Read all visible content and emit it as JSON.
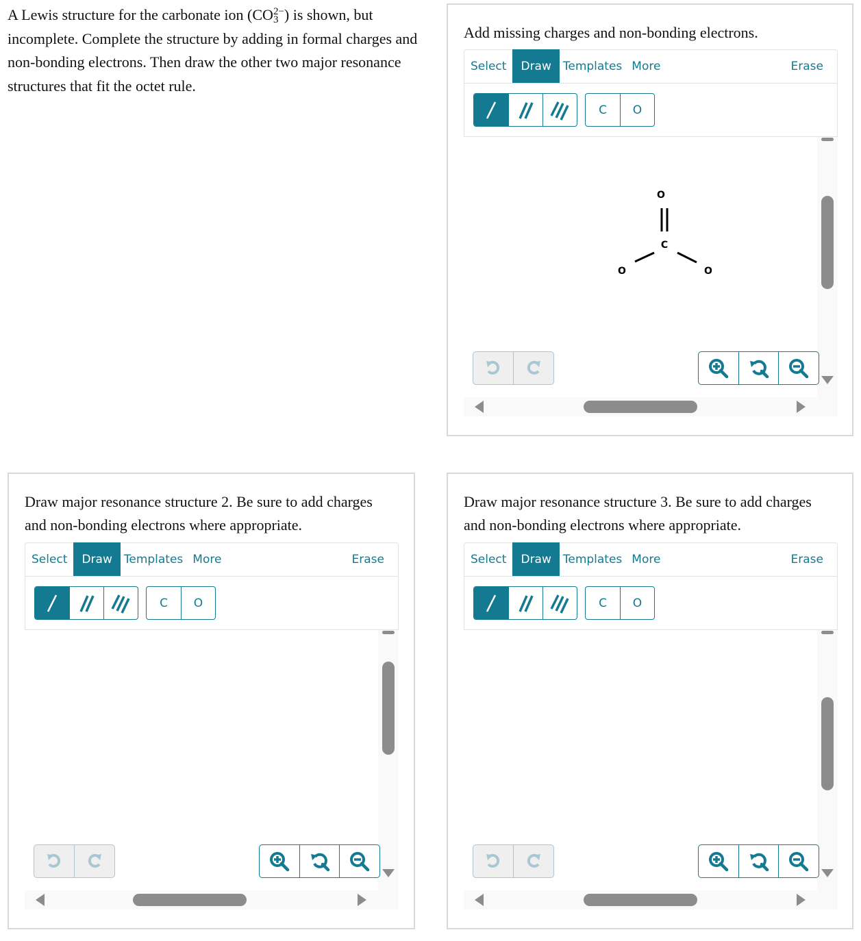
{
  "intro": {
    "text_before": "A Lewis structure for the carbonate ion (CO",
    "subscript": "3",
    "superscript": "2−",
    "text_after": ") is shown, but incomplete. Complete the structure by adding in formal charges and non-bonding electrons. Then draw the other two major resonance structures that fit the octet rule."
  },
  "panels": [
    {
      "prompt": "Add missing charges and non-bonding electrons."
    },
    {
      "prompt": "Draw major resonance structure 2. Be sure to add charges and non-bonding electrons where appropriate."
    },
    {
      "prompt": "Draw major resonance structure 3. Be sure to add charges and non-bonding electrons where appropriate."
    }
  ],
  "toolbar": {
    "select": "Select",
    "draw": "Draw",
    "templates": "Templates",
    "more": "More",
    "erase": "Erase"
  },
  "tools": {
    "bonds": [
      "single-bond-icon",
      "double-bond-icon",
      "triple-bond-icon"
    ],
    "atoms": [
      "C",
      "O"
    ],
    "active_tab": "Draw",
    "active_tool": "single-bond"
  },
  "molecule": {
    "atoms": [
      "O",
      "C",
      "O",
      "O"
    ],
    "bonds": [
      "C=O (top, double)",
      "C–O (left, single)",
      "C–O (right, single)"
    ]
  },
  "colors": {
    "accent": "#147a91",
    "scrollbar": "#8c8c8c",
    "disabled": "#a9c7d0"
  }
}
